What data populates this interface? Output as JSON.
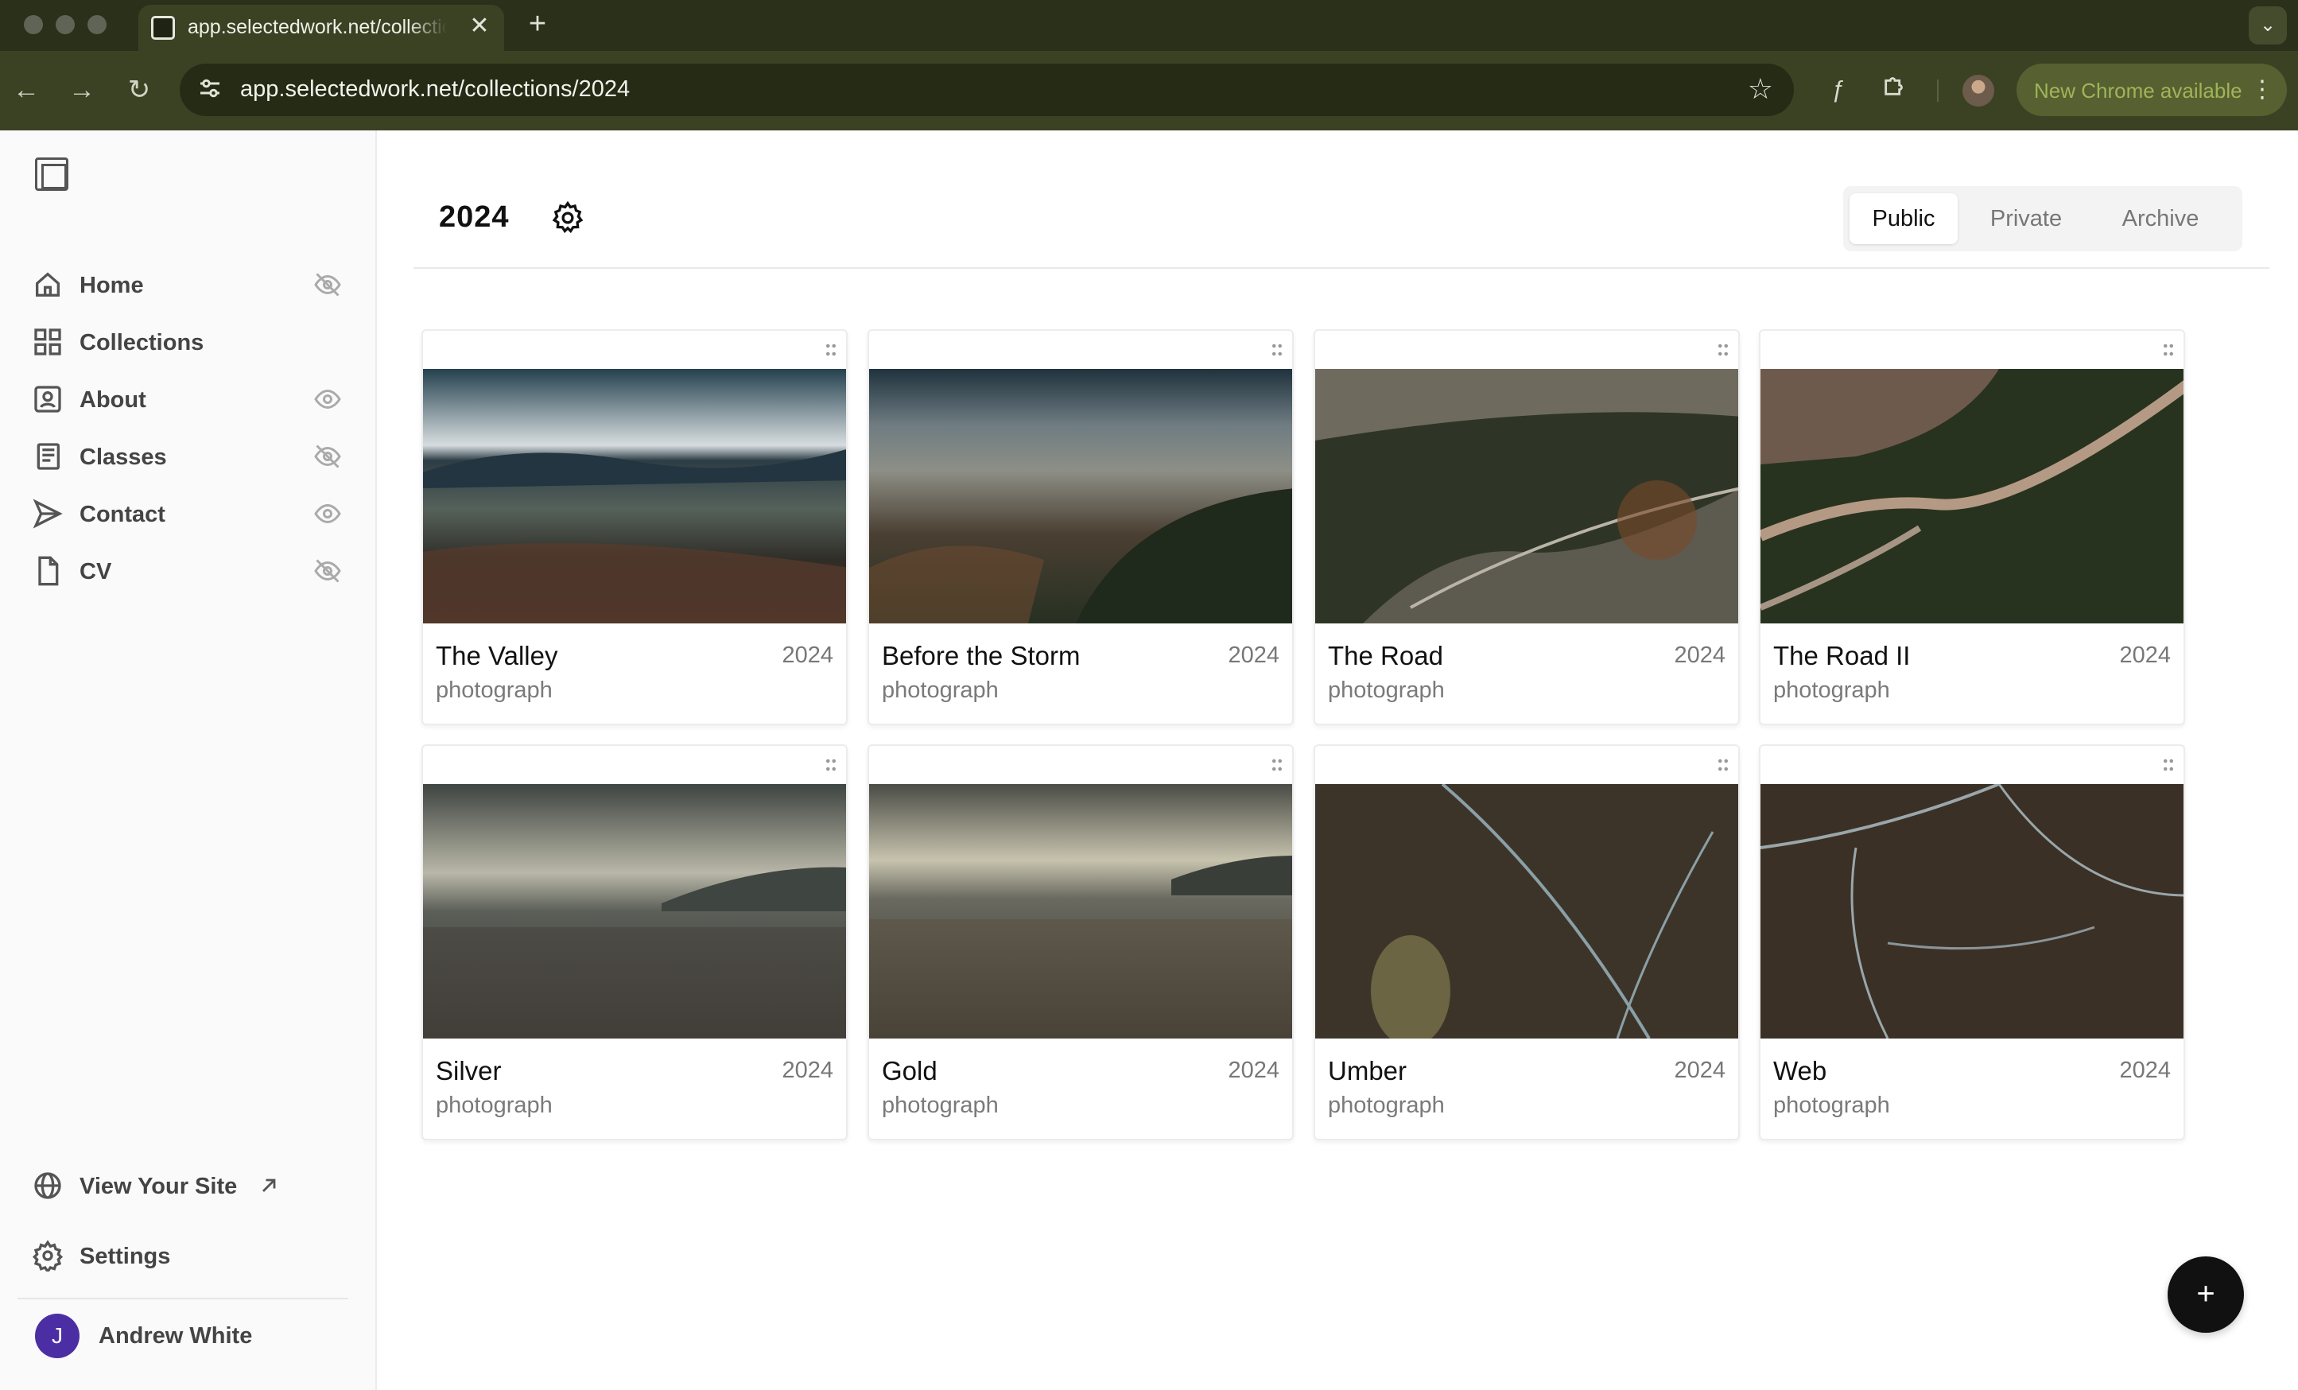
{
  "browser": {
    "tab_title": "app.selectedwork.net/collections/2024",
    "tab_close": "✕",
    "new_tab": "+",
    "url": "app.selectedwork.net/collections/2024",
    "update_label": "New Chrome available",
    "profile_menu": "⋮"
  },
  "sidebar": {
    "nav": [
      {
        "label": "Home",
        "visibility": "hidden"
      },
      {
        "label": "Collections"
      },
      {
        "label": "About",
        "visibility": "visible"
      },
      {
        "label": "Classes",
        "visibility": "hidden"
      },
      {
        "label": "Contact",
        "visibility": "visible"
      },
      {
        "label": "CV",
        "visibility": "hidden"
      }
    ],
    "view_site": "View Your Site",
    "settings": "Settings",
    "user": {
      "initial": "J",
      "name": "Andrew White",
      "avatar_color": "#4b2ea3"
    }
  },
  "main": {
    "title": "2024",
    "segments": [
      {
        "label": "Public",
        "active": true
      },
      {
        "label": "Private",
        "active": false
      },
      {
        "label": "Archive",
        "active": false
      }
    ],
    "cards": [
      {
        "title": "The Valley",
        "year": "2024",
        "type": "photograph"
      },
      {
        "title": "Before the Storm",
        "year": "2024",
        "type": "photograph"
      },
      {
        "title": "The Road",
        "year": "2024",
        "type": "photograph"
      },
      {
        "title": "The Road II",
        "year": "2024",
        "type": "photograph"
      },
      {
        "title": "Silver",
        "year": "2024",
        "type": "photograph"
      },
      {
        "title": "Gold",
        "year": "2024",
        "type": "photograph"
      },
      {
        "title": "Umber",
        "year": "2024",
        "type": "photograph"
      },
      {
        "title": "Web",
        "year": "2024",
        "type": "photograph"
      }
    ],
    "fab_label": "+"
  }
}
